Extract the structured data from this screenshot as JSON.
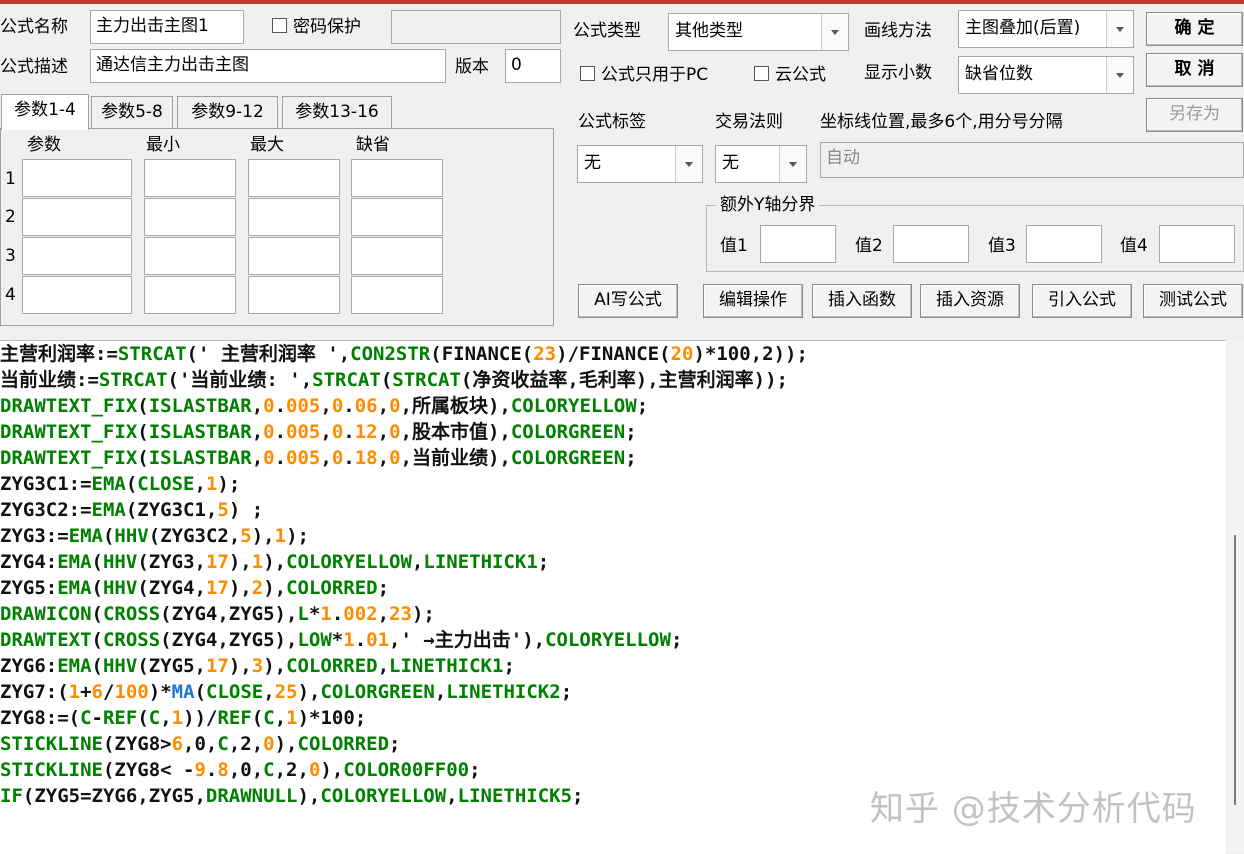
{
  "form": {
    "name_label": "公式名称",
    "name_value": "主力出击主图1",
    "password_label": "密码保护",
    "desc_label": "公式描述",
    "desc_value": "通达信主力出击主图",
    "version_label": "版本",
    "version_value": "0"
  },
  "tabs": [
    "参数1-4",
    "参数5-8",
    "参数9-12",
    "参数13-16"
  ],
  "params": {
    "headers": [
      "参数",
      "最小",
      "最大",
      "缺省"
    ],
    "rows": [
      "1",
      "2",
      "3",
      "4"
    ]
  },
  "right": {
    "type_label": "公式类型",
    "type_value": "其他类型",
    "draw_label": "画线方法",
    "draw_value": "主图叠加(后置)",
    "pc_only_label": "公式只用于PC",
    "cloud_label": "云公式",
    "decimals_label": "显示小数",
    "decimals_value": "缺省位数",
    "tag_label": "公式标签",
    "tag_value": "无",
    "rule_label": "交易法则",
    "rule_value": "无",
    "coord_label": "坐标线位置,最多6个,用分号分隔",
    "coord_value": "自动",
    "yaxis_label": "额外Y轴分界",
    "y_values": [
      "值1",
      "值2",
      "值3",
      "值4"
    ]
  },
  "buttons": {
    "ok": "确  定",
    "cancel": "取  消",
    "save_as": "另存为",
    "ai": "AI写公式",
    "edit": "编辑操作",
    "insert_func": "插入函数",
    "insert_res": "插入资源",
    "import": "引入公式",
    "test": "测试公式"
  },
  "code_colors": {
    "default": "#111111",
    "function": "#008000",
    "number": "#ff8c00",
    "builtin": "#1e78d2"
  },
  "code_lines": [
    [
      [
        "d",
        "主营利润率:="
      ],
      [
        "f",
        "STRCAT"
      ],
      [
        "d",
        "(' 主营利润率 ',"
      ],
      [
        "f",
        "CON2STR"
      ],
      [
        "d",
        "("
      ],
      [
        "d",
        "FINANCE"
      ],
      [
        "d",
        "("
      ],
      [
        "n",
        "23"
      ],
      [
        "d",
        ")/"
      ],
      [
        "d",
        "FINANCE"
      ],
      [
        "d",
        "("
      ],
      [
        "n",
        "20"
      ],
      [
        "d",
        ")*"
      ],
      [
        "d",
        "100"
      ],
      [
        "d",
        ","
      ],
      [
        "d",
        "2"
      ],
      [
        "d",
        "));"
      ]
    ],
    [
      [
        "d",
        "当前业绩:="
      ],
      [
        "f",
        "STRCAT"
      ],
      [
        "d",
        "('当前业绩: ',"
      ],
      [
        "f",
        "STRCAT"
      ],
      [
        "d",
        "("
      ],
      [
        "f",
        "STRCAT"
      ],
      [
        "d",
        "(净资收益率,毛利率),主营利润率));"
      ]
    ],
    [
      [
        "f",
        "DRAWTEXT_FIX"
      ],
      [
        "d",
        "("
      ],
      [
        "f",
        "ISLASTBAR"
      ],
      [
        "d",
        ","
      ],
      [
        "n",
        "0"
      ],
      [
        "d",
        "."
      ],
      [
        "n",
        "005"
      ],
      [
        "d",
        ","
      ],
      [
        "n",
        "0"
      ],
      [
        "d",
        "."
      ],
      [
        "n",
        "06"
      ],
      [
        "d",
        ","
      ],
      [
        "n",
        "0"
      ],
      [
        "d",
        ",所属板块),"
      ],
      [
        "f",
        "COLORYELLOW"
      ],
      [
        "d",
        ";"
      ]
    ],
    [
      [
        "f",
        "DRAWTEXT_FIX"
      ],
      [
        "d",
        "("
      ],
      [
        "f",
        "ISLASTBAR"
      ],
      [
        "d",
        ","
      ],
      [
        "n",
        "0"
      ],
      [
        "d",
        "."
      ],
      [
        "n",
        "005"
      ],
      [
        "d",
        ","
      ],
      [
        "n",
        "0"
      ],
      [
        "d",
        "."
      ],
      [
        "n",
        "12"
      ],
      [
        "d",
        ","
      ],
      [
        "n",
        "0"
      ],
      [
        "d",
        ",股本市值),"
      ],
      [
        "f",
        "COLORGREEN"
      ],
      [
        "d",
        ";"
      ]
    ],
    [
      [
        "f",
        "DRAWTEXT_FIX"
      ],
      [
        "d",
        "("
      ],
      [
        "f",
        "ISLASTBAR"
      ],
      [
        "d",
        ","
      ],
      [
        "n",
        "0"
      ],
      [
        "d",
        "."
      ],
      [
        "n",
        "005"
      ],
      [
        "d",
        ","
      ],
      [
        "n",
        "0"
      ],
      [
        "d",
        "."
      ],
      [
        "n",
        "18"
      ],
      [
        "d",
        ","
      ],
      [
        "n",
        "0"
      ],
      [
        "d",
        ",当前业绩),"
      ],
      [
        "f",
        "COLORGREEN"
      ],
      [
        "d",
        ";"
      ]
    ],
    [
      [
        "d",
        "ZYG3C1:="
      ],
      [
        "f",
        "EMA"
      ],
      [
        "d",
        "("
      ],
      [
        "f",
        "CLOSE"
      ],
      [
        "d",
        ","
      ],
      [
        "n",
        "1"
      ],
      [
        "d",
        ");"
      ]
    ],
    [
      [
        "d",
        "ZYG3C2:="
      ],
      [
        "f",
        "EMA"
      ],
      [
        "d",
        "(ZYG3C1,"
      ],
      [
        "n",
        "5"
      ],
      [
        "d",
        ") ;"
      ]
    ],
    [
      [
        "d",
        "ZYG3:="
      ],
      [
        "f",
        "EMA"
      ],
      [
        "d",
        "("
      ],
      [
        "f",
        "HHV"
      ],
      [
        "d",
        "(ZYG3C2,"
      ],
      [
        "n",
        "5"
      ],
      [
        "d",
        "),"
      ],
      [
        "n",
        "1"
      ],
      [
        "d",
        ");"
      ]
    ],
    [
      [
        "d",
        "ZYG4:"
      ],
      [
        "f",
        "EMA"
      ],
      [
        "d",
        "("
      ],
      [
        "f",
        "HHV"
      ],
      [
        "d",
        "(ZYG3,"
      ],
      [
        "n",
        "17"
      ],
      [
        "d",
        "),"
      ],
      [
        "n",
        "1"
      ],
      [
        "d",
        "),"
      ],
      [
        "f",
        "COLORYELLOW"
      ],
      [
        "d",
        ","
      ],
      [
        "f",
        "LINETHICK1"
      ],
      [
        "d",
        ";"
      ]
    ],
    [
      [
        "d",
        "ZYG5:"
      ],
      [
        "f",
        "EMA"
      ],
      [
        "d",
        "("
      ],
      [
        "f",
        "HHV"
      ],
      [
        "d",
        "(ZYG4,"
      ],
      [
        "n",
        "17"
      ],
      [
        "d",
        "),"
      ],
      [
        "n",
        "2"
      ],
      [
        "d",
        "),"
      ],
      [
        "f",
        "COLORRED"
      ],
      [
        "d",
        ";"
      ]
    ],
    [
      [
        "f",
        "DRAWICON"
      ],
      [
        "d",
        "("
      ],
      [
        "f",
        "CROSS"
      ],
      [
        "d",
        "(ZYG4,ZYG5),"
      ],
      [
        "f",
        "L"
      ],
      [
        "d",
        "*"
      ],
      [
        "n",
        "1"
      ],
      [
        "d",
        "."
      ],
      [
        "n",
        "002"
      ],
      [
        "d",
        ","
      ],
      [
        "n",
        "23"
      ],
      [
        "d",
        ");"
      ]
    ],
    [
      [
        "f",
        "DRAWTEXT"
      ],
      [
        "d",
        "("
      ],
      [
        "f",
        "CROSS"
      ],
      [
        "d",
        "(ZYG4,ZYG5),"
      ],
      [
        "f",
        "LOW"
      ],
      [
        "d",
        "*"
      ],
      [
        "n",
        "1"
      ],
      [
        "d",
        "."
      ],
      [
        "n",
        "01"
      ],
      [
        "d",
        ",' →主力出击'),"
      ],
      [
        "f",
        "COLORYELLOW"
      ],
      [
        "d",
        ";"
      ]
    ],
    [
      [
        "d",
        "ZYG6:"
      ],
      [
        "f",
        "EMA"
      ],
      [
        "d",
        "("
      ],
      [
        "f",
        "HHV"
      ],
      [
        "d",
        "(ZYG5,"
      ],
      [
        "n",
        "17"
      ],
      [
        "d",
        "),"
      ],
      [
        "n",
        "3"
      ],
      [
        "d",
        "),"
      ],
      [
        "f",
        "COLORRED"
      ],
      [
        "d",
        ","
      ],
      [
        "f",
        "LINETHICK1"
      ],
      [
        "d",
        ";"
      ]
    ],
    [
      [
        "d",
        "ZYG7:("
      ],
      [
        "n",
        "1"
      ],
      [
        "d",
        "+"
      ],
      [
        "n",
        "6"
      ],
      [
        "d",
        "/"
      ],
      [
        "n",
        "100"
      ],
      [
        "d",
        ")*"
      ],
      [
        "b",
        "MA"
      ],
      [
        "d",
        "("
      ],
      [
        "f",
        "CLOSE"
      ],
      [
        "d",
        ","
      ],
      [
        "n",
        "25"
      ],
      [
        "d",
        "),"
      ],
      [
        "f",
        "COLORGREEN"
      ],
      [
        "d",
        ","
      ],
      [
        "f",
        "LINETHICK2"
      ],
      [
        "d",
        ";"
      ]
    ],
    [
      [
        "d",
        "ZYG8:=("
      ],
      [
        "f",
        "C"
      ],
      [
        "d",
        "-"
      ],
      [
        "f",
        "REF"
      ],
      [
        "d",
        "("
      ],
      [
        "f",
        "C"
      ],
      [
        "d",
        ","
      ],
      [
        "n",
        "1"
      ],
      [
        "d",
        "))/"
      ],
      [
        "f",
        "REF"
      ],
      [
        "d",
        "("
      ],
      [
        "f",
        "C"
      ],
      [
        "d",
        ","
      ],
      [
        "n",
        "1"
      ],
      [
        "d",
        ")*"
      ],
      [
        "d",
        "100"
      ],
      [
        "d",
        ";"
      ]
    ],
    [
      [
        "f",
        "STICKLINE"
      ],
      [
        "d",
        "(ZYG8>"
      ],
      [
        "n",
        "6"
      ],
      [
        "d",
        ",0,"
      ],
      [
        "f",
        "C"
      ],
      [
        "d",
        ",2,"
      ],
      [
        "n",
        "0"
      ],
      [
        "d",
        "),"
      ],
      [
        "f",
        "COLORRED"
      ],
      [
        "d",
        ";"
      ]
    ],
    [
      [
        "f",
        "STICKLINE"
      ],
      [
        "d",
        "(ZYG8< -"
      ],
      [
        "n",
        "9"
      ],
      [
        "d",
        "."
      ],
      [
        "n",
        "8"
      ],
      [
        "d",
        ",0,"
      ],
      [
        "f",
        "C"
      ],
      [
        "d",
        ",2,"
      ],
      [
        "n",
        "0"
      ],
      [
        "d",
        "),"
      ],
      [
        "f",
        "COLOR00FF00"
      ],
      [
        "d",
        ";"
      ]
    ],
    [
      [
        "f",
        "IF"
      ],
      [
        "d",
        "(ZYG5=ZYG6,ZYG5,"
      ],
      [
        "f",
        "DRAWNULL"
      ],
      [
        "d",
        "),"
      ],
      [
        "f",
        "COLORYELLOW"
      ],
      [
        "d",
        ","
      ],
      [
        "f",
        "LINETHICK5"
      ],
      [
        "d",
        ";"
      ]
    ]
  ],
  "watermark": "知乎 @技术分析代码"
}
